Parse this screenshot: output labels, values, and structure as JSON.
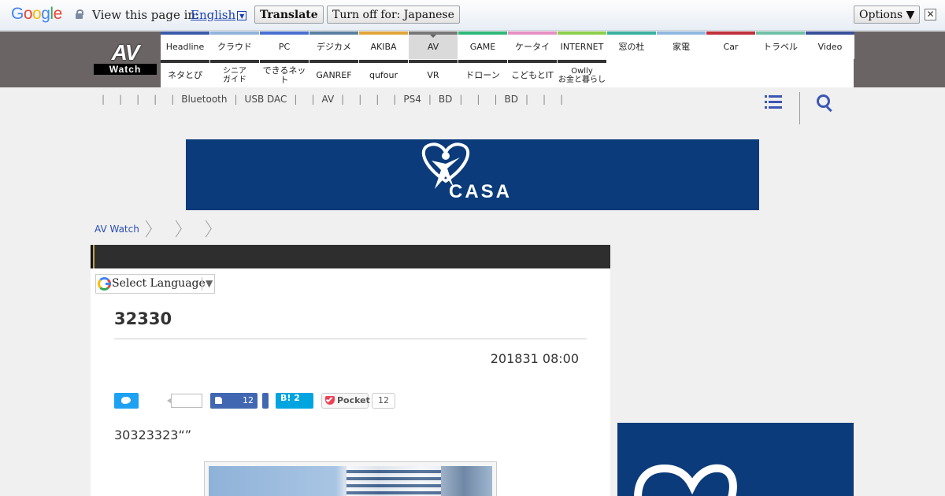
{
  "translate_bar": {
    "logo": "Google",
    "prompt": "View this page in:",
    "language": "English",
    "translate_label": "Translate",
    "turn_off_label": "Turn off for: Japanese",
    "options_label": "Options ▼",
    "close_glyph": "✕"
  },
  "site": {
    "logo_top": "AV",
    "logo_bottom": "Watch"
  },
  "nav": {
    "row1": [
      {
        "label": "Headline",
        "color": "#3b5aa8"
      },
      {
        "label": "クラウド",
        "color": "#8fb3d9"
      },
      {
        "label": "PC",
        "color": "#4a6fd1"
      },
      {
        "label": "デジカメ",
        "color": "#5a7fa0"
      },
      {
        "label": "AKIBA",
        "color": "#e0a43a"
      },
      {
        "label": "AV",
        "color": "#777777",
        "active": true
      },
      {
        "label": "GAME",
        "color": "#2fb87a"
      },
      {
        "label": "ケータイ",
        "color": "#e58fc4"
      },
      {
        "label": "INTERNET",
        "color": "#8ccf4a"
      },
      {
        "label": "窓の杜",
        "color": "#3ab0a0"
      },
      {
        "label": "家電",
        "color": "#8fb8e0"
      },
      {
        "label": "Car",
        "color": "#c0303a"
      },
      {
        "label": "トラベル",
        "color": "#6fc0a6"
      },
      {
        "label": "Video",
        "color": "#3a4f9a"
      }
    ],
    "row2": [
      {
        "label": "ネタとぴ"
      },
      {
        "label": "シニア\nガイド"
      },
      {
        "label": "できるネット"
      },
      {
        "label": "GANREF"
      },
      {
        "label": "qufour"
      },
      {
        "label": "VR"
      },
      {
        "label": "ドローン"
      },
      {
        "label": "こどもとIT"
      },
      {
        "label": "Owlly\nお金と暮らし"
      }
    ]
  },
  "subnav": {
    "items": [
      "",
      "",
      "",
      "",
      "Bluetooth",
      "USB DAC",
      "",
      "AV",
      "",
      "",
      "",
      "PS4",
      "BD",
      "",
      "",
      "BD",
      "",
      "",
      ""
    ]
  },
  "icons": {
    "menu": "menu-icon",
    "search": "search-icon"
  },
  "banner": {
    "brand": "CASA",
    "color": "#0b3b7a"
  },
  "breadcrumb": {
    "home": "AV Watch"
  },
  "article": {
    "language_widget": "Select Language",
    "language_arrow": "▼",
    "title": "32330",
    "date": "201831 08:00",
    "share": {
      "facebook_count": "12",
      "hatena_label": "B! 2",
      "pocket_label": "Pocket",
      "pocket_count": "12",
      "tweet_count": ""
    },
    "lead": "30323323“”"
  }
}
